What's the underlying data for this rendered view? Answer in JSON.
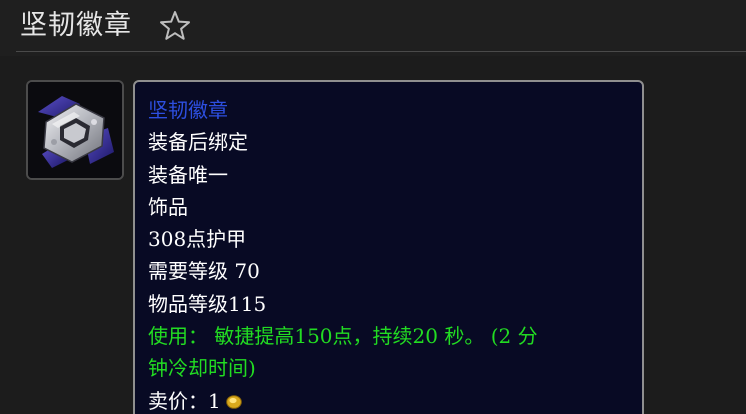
{
  "page": {
    "title": "坚韧徽章",
    "favorite_icon": "star-outline-icon"
  },
  "item": {
    "icon": "badge-icon",
    "name": "坚韧徽章",
    "binding": "装备后绑定",
    "unique": "装备唯一",
    "slot": "饰品",
    "armor": "308点护甲",
    "required_level": "需要等级 70",
    "item_level": "物品等级115",
    "use_effect_line1": "使用： 敏捷提高150点，持续20 秒。 (2 分",
    "use_effect_line2": "钟冷却时间)",
    "sell_price_label": "卖价：",
    "sell_price_value": "1",
    "currency_icon": "gold-coin-icon"
  },
  "colors": {
    "item_name": "#2d4fe0",
    "use_effect": "#22dc22",
    "tooltip_bg": "#080a24"
  }
}
